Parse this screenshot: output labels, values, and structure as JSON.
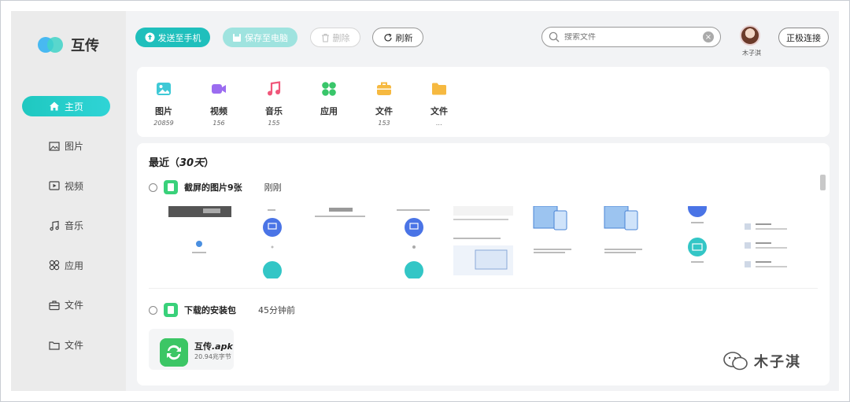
{
  "app": {
    "name": "互传"
  },
  "nav": {
    "items": [
      {
        "id": "home",
        "label": "主页",
        "icon": "home-icon",
        "active": true
      },
      {
        "id": "images",
        "label": "图片",
        "icon": "image-icon"
      },
      {
        "id": "video",
        "label": "视频",
        "icon": "video-icon"
      },
      {
        "id": "music",
        "label": "音乐",
        "icon": "music-icon"
      },
      {
        "id": "apps",
        "label": "应用",
        "icon": "apps-icon"
      },
      {
        "id": "docs",
        "label": "文件",
        "icon": "briefcase-icon"
      },
      {
        "id": "folders",
        "label": "文件",
        "icon": "folder-icon"
      }
    ]
  },
  "toolbar": {
    "send_label": "发送至手机",
    "save_label": "保存至电脑",
    "delete_label": "删除",
    "refresh_label": "刷新",
    "connect_label": "正极连接"
  },
  "search": {
    "placeholder": "搜索文件"
  },
  "user": {
    "name": "木子淇"
  },
  "categories": [
    {
      "label": "图片",
      "count": "20859",
      "icon": "image-icon",
      "color": "#3ec9d6"
    },
    {
      "label": "视频",
      "count": "156",
      "icon": "video-icon",
      "color": "#9b6cf0"
    },
    {
      "label": "音乐",
      "count": "155",
      "icon": "music-icon",
      "color": "#f0567a"
    },
    {
      "label": "应用",
      "count": "",
      "icon": "apps-icon",
      "color": "#39c66a"
    },
    {
      "label": "文件",
      "count": "153",
      "icon": "briefcase-icon",
      "color": "#f6b940"
    },
    {
      "label": "文件",
      "count": "…",
      "icon": "folder-icon",
      "color": "#f6b940"
    }
  ],
  "recent": {
    "title_prefix": "最近（",
    "title_em": "30天",
    "title_suffix": "）",
    "groups": [
      {
        "name": "截屏的图片9张",
        "time": "刚刚"
      },
      {
        "name": "下载的安装包",
        "time": "45分钟前"
      }
    ],
    "apk": {
      "name_prefix": "互传",
      "name_ext": ".apk",
      "size": "20.94兆字节"
    }
  },
  "watermark": {
    "text": "木子淇"
  },
  "colors": {
    "accent": "#1fbfbc",
    "accent_light": "#9fe3df",
    "sidebar_bg": "#ebebeb",
    "main_bg": "#f2f3f5"
  }
}
